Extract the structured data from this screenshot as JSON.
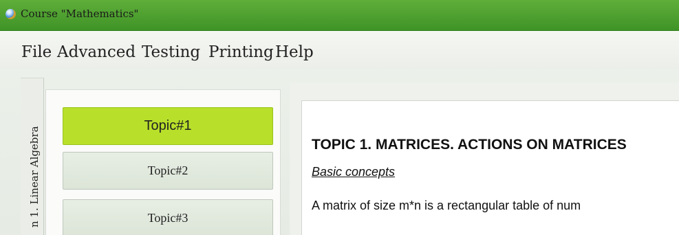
{
  "window": {
    "title": "Course \"Mathematics\"",
    "icon": "globe-app-icon"
  },
  "menu": [
    {
      "label": "File"
    },
    {
      "label": "Advanced"
    },
    {
      "label": "Testing"
    },
    {
      "label": "Printing"
    },
    {
      "label": "Help"
    }
  ],
  "sidebar": {
    "vertical_tab_label": "n 1. Linear Algebra"
  },
  "topics": [
    {
      "label": "Topic#1",
      "active": true
    },
    {
      "label": "Topic#2",
      "active": false
    },
    {
      "label": "Topic#3",
      "active": false
    }
  ],
  "content": {
    "heading": "TOPIC 1. MATRICES. ACTIONS ON MATRICES",
    "subheading": "Basic concepts",
    "definition": "A matrix of size m*n is a rectangular table of num"
  },
  "colors": {
    "titlebar": "#4fa130",
    "active_topic": "#b8e02a",
    "background": "#eef1ec"
  }
}
